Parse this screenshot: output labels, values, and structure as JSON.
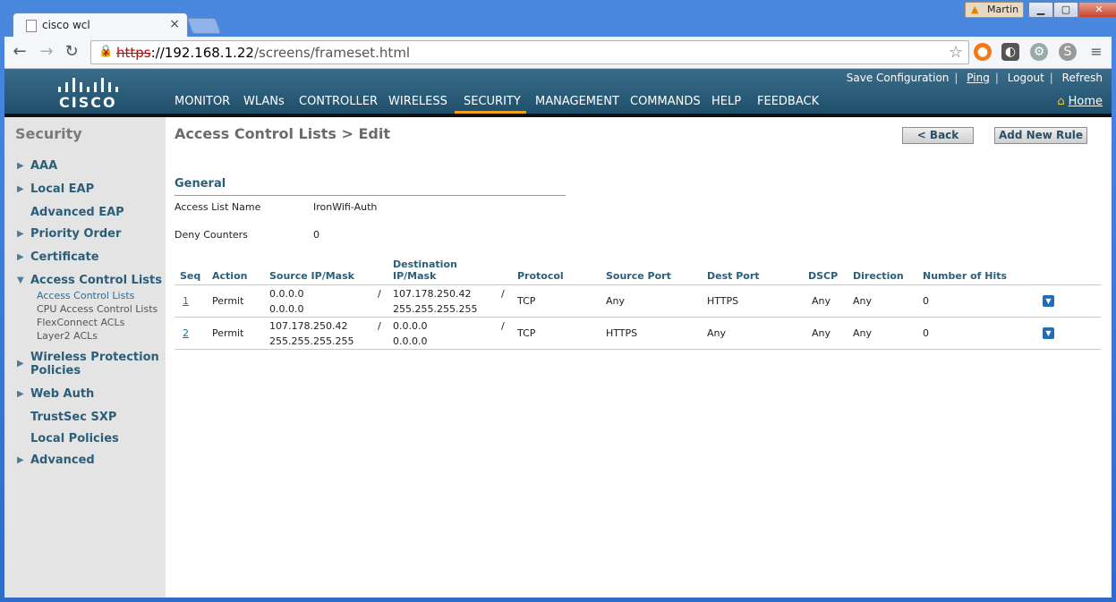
{
  "browser": {
    "tab_title": "cisco wcl",
    "user": "Martin",
    "url_scheme": "https",
    "url_host": "://192.168.1.22",
    "url_path": "/screens/frameset.html"
  },
  "header": {
    "brand": "CISCO",
    "top_links": [
      "Save Configuration",
      "Ping",
      "Logout",
      "Refresh"
    ],
    "nav": [
      "MONITOR",
      "WLANs",
      "CONTROLLER",
      "WIRELESS",
      "SECURITY",
      "MANAGEMENT",
      "COMMANDS",
      "HELP",
      "FEEDBACK"
    ],
    "active_nav": "SECURITY",
    "home": "Home"
  },
  "sidebar": {
    "title": "Security",
    "items": [
      {
        "label": "AAA",
        "arrow": "▶"
      },
      {
        "label": "Local EAP",
        "arrow": "▶"
      },
      {
        "label": "Advanced EAP",
        "arrow": ""
      },
      {
        "label": "Priority Order",
        "arrow": "▶"
      },
      {
        "label": "Certificate",
        "arrow": "▶"
      },
      {
        "label": "Access Control Lists",
        "arrow": "▼"
      },
      {
        "label": "Wireless Protection",
        "arrow": "▶"
      },
      {
        "label": "Policies",
        "arrow": ""
      },
      {
        "label": "Web Auth",
        "arrow": "▶"
      },
      {
        "label": "TrustSec SXP",
        "arrow": ""
      },
      {
        "label": "Local Policies",
        "arrow": ""
      },
      {
        "label": "Advanced",
        "arrow": "▶"
      }
    ],
    "acl_sub": [
      "Access Control Lists",
      "CPU Access Control Lists",
      "FlexConnect ACLs",
      "Layer2 ACLs"
    ]
  },
  "main": {
    "title": "Access Control Lists > Edit",
    "back_label": "< Back",
    "add_label": "Add New Rule",
    "section": "General",
    "access_list_name_label": "Access List Name",
    "access_list_name": "IronWifi-Auth",
    "deny_counters_label": "Deny Counters",
    "deny_counters": "0",
    "columns": {
      "seq": "Seq",
      "action": "Action",
      "source": "Source IP/Mask",
      "dest1": "Destination",
      "dest2": "IP/Mask",
      "protocol": "Protocol",
      "source_port": "Source Port",
      "dest_port": "Dest Port",
      "dscp": "DSCP",
      "direction": "Direction",
      "hits": "Number of Hits"
    },
    "rows": [
      {
        "seq": "1",
        "action": "Permit",
        "src_ip": "0.0.0.0",
        "src_mask": "0.0.0.0",
        "slash": "/",
        "dst_ip": "107.178.250.42",
        "dst_mask": "255.255.255.255",
        "protocol": "TCP",
        "source_port": "Any",
        "dest_port": "HTTPS",
        "dscp": "Any",
        "direction": "Any",
        "hits": "0"
      },
      {
        "seq": "2",
        "action": "Permit",
        "src_ip": "107.178.250.42",
        "src_mask": "255.255.255.255",
        "slash": "/",
        "dst_ip": "0.0.0.0",
        "dst_mask": "0.0.0.0",
        "protocol": "TCP",
        "source_port": "HTTPS",
        "dest_port": "Any",
        "dscp": "Any",
        "direction": "Any",
        "hits": "0"
      }
    ]
  },
  "colors": {
    "accent": "#f4a21e",
    "header": "#2a5d7a",
    "link": "#2b6c9a"
  }
}
